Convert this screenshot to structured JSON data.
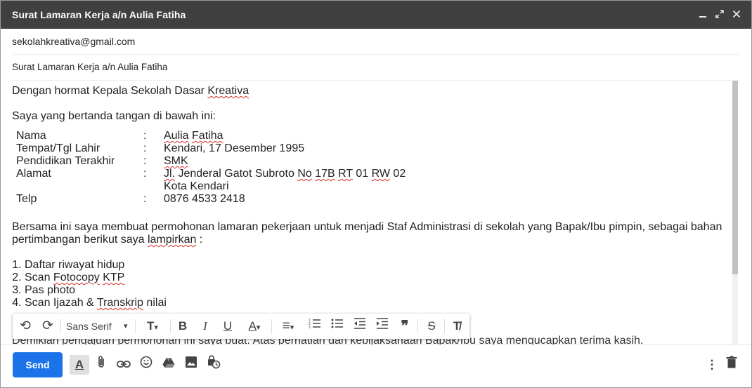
{
  "window": {
    "title": "Surat Lamaran Kerja a/n Aulia Fatiha",
    "minimize_icon": "minimize-icon",
    "expand_icon": "expand-icon",
    "close_icon": "close-icon"
  },
  "to": "sekolahkreativa@gmail.com",
  "subject": "Surat Lamaran Kerja a/n Aulia Fatiha",
  "body": {
    "greeting_prefix": "Dengan hormat Kepala Sekolah Dasar ",
    "greeting_word": "Kreativa",
    "intro": "Saya yang bertanda tangan di bawah ini:",
    "labels": {
      "nama": "Nama",
      "ttl": "Tempat/Tgl Lahir",
      "pendidikan": "Pendidikan Terakhir",
      "alamat": "Alamat",
      "telp": "Telp"
    },
    "colon": ":",
    "values": {
      "nama_a": "Aulia",
      "nama_b": "Fatiha",
      "ttl": "Kendari, 17 Desember 1995",
      "pendidikan": "SMK",
      "alamat_1": "Jl.",
      "alamat_2": " Jenderal Gatot Subroto ",
      "alamat_3": "No",
      "alamat_4": " ",
      "alamat_5": "17B",
      "alamat_6": " ",
      "alamat_7": "RT",
      "alamat_8": " 01 ",
      "alamat_9": "RW",
      "alamat_10": " 02",
      "alamat_line2": "Kota Kendari",
      "telp": "0876 4533 2418"
    },
    "para1": "Bersama ini saya membuat permohonan lamaran pekerjaan untuk menjadi Staf Administrasi di sekolah yang Bapak/Ibu pimpin, sebagai bahan",
    "para1b_prefix": "pertimbangan berikut saya ",
    "para1b_word": "lampirkan",
    "para1b_suffix": " :",
    "list": {
      "item1": "Daftar riwayat hidup",
      "item2_prefix": "Scan ",
      "item2_w1": "Fotocopy",
      "item2_space": " ",
      "item2_w2": "KTP",
      "item3": "Pas photo",
      "item4_prefix": "Scan Ijazah & ",
      "item4_word": "Transkrip",
      "item4_suffix": " nilai"
    },
    "closing": "Demikian pengajuan permohonan ini saya buat. Atas perhatian dan kebijaksanaan Bapak/Ibu saya mengucapkan terima kasih."
  },
  "format_toolbar": {
    "font": "Sans Serif",
    "undo_glyph": "⟲",
    "redo_glyph": "⟳",
    "size_glyph": "T",
    "bold_glyph": "B",
    "italic_glyph": "I",
    "underline_glyph": "U",
    "color_glyph": "A",
    "align_glyph": "≡",
    "numbered_glyph": "☰",
    "bullet_glyph": "☷",
    "indent_less_glyph": "⇤",
    "indent_more_glyph": "⇥",
    "quote_glyph": "❞",
    "strike_glyph": "S",
    "clear_glyph": "T̸",
    "caret": "▾"
  },
  "bottom_bar": {
    "send_label": "Send",
    "formatting_glyph": "A",
    "attach_glyph": "📎",
    "link_glyph": "🔗",
    "emoji_glyph": "☺",
    "drive_glyph": "▲",
    "photo_glyph": "▣",
    "confidential_glyph": "⏲",
    "more_glyph": "⋮",
    "discard_glyph": "🗑"
  },
  "colors": {
    "titlebar": "#404040",
    "send": "#1a73e8"
  }
}
